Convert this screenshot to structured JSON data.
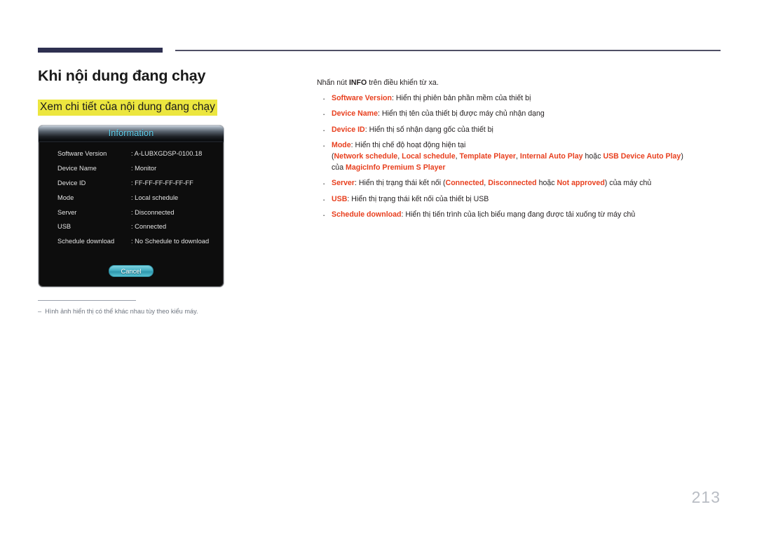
{
  "page": {
    "number": "213"
  },
  "left": {
    "title": "Khi nội dung đang chạy",
    "sub_heading": "Xem chi tiết của nội dung đang chạy",
    "footnote_dash": "‒",
    "footnote": "Hình ảnh hiển thị có thể khác nhau tùy theo kiểu máy."
  },
  "dialog": {
    "title": "Information",
    "rows": [
      {
        "key": "Software Version",
        "value": ": A-LUBXGDSP-0100.18"
      },
      {
        "key": "Device Name",
        "value": ": Monitor"
      },
      {
        "key": "Device ID",
        "value": ": FF-FF-FF-FF-FF-FF"
      },
      {
        "key": "Mode",
        "value": ": Local schedule"
      },
      {
        "key": "Server",
        "value": ": Disconnected"
      },
      {
        "key": "USB",
        "value": ": Connected"
      },
      {
        "key": "Schedule download",
        "value": ": No Schedule to download"
      }
    ],
    "cancel_label": "Cancel",
    "accent_title_color": "#5fd0ef",
    "accent_button_color": "#49b3c6"
  },
  "right": {
    "intro_before": "Nhấn nút ",
    "intro_bold": "INFO",
    "intro_after": " trên điều khiển từ xa.",
    "bullets": [
      {
        "term": "Software Version",
        "desc": ": Hiển thị phiên bản phần mềm của thiết bị"
      },
      {
        "term": "Device Name",
        "desc": ": Hiển thị tên của thiết bị được máy chủ nhận dạng"
      },
      {
        "term": "Device ID",
        "desc": ": Hiển thị số nhận dạng gốc của thiết bị"
      },
      {
        "term": "Mode",
        "desc": ": Hiển thị chế độ hoạt động hiện tại",
        "sub_open": "(",
        "opt1": "Network schedule",
        "sep1": ", ",
        "opt2": "Local schedule",
        "sep2": ", ",
        "opt3": "Template Player",
        "sep3": ", ",
        "opt4": "Internal Auto Play",
        "sep4": " hoặc ",
        "opt5": "USB Device Auto Play",
        "sub_close": ")",
        "sub_line2_before": "của ",
        "sub_line2_opt": "MagicInfo Premium S Player"
      },
      {
        "term": "Server",
        "desc_before": ": Hiển thị trạng thái kết nối (",
        "opt1": "Connected",
        "sep1": ", ",
        "opt2": "Disconnected",
        "sep2": " hoặc ",
        "opt3": "Not approved",
        "desc_after": ") của máy chủ"
      },
      {
        "term": "USB",
        "desc": ": Hiển thị trạng thái kết nối của thiết bị USB"
      },
      {
        "term": "Schedule download",
        "desc": ": Hiển thị tiến trình của lịch biểu mạng đang được tải xuống từ máy chủ"
      }
    ]
  },
  "colors": {
    "term_red": "#e8401f",
    "highlight_yellow": "#ece63f",
    "rule_navy": "#2e3050"
  }
}
